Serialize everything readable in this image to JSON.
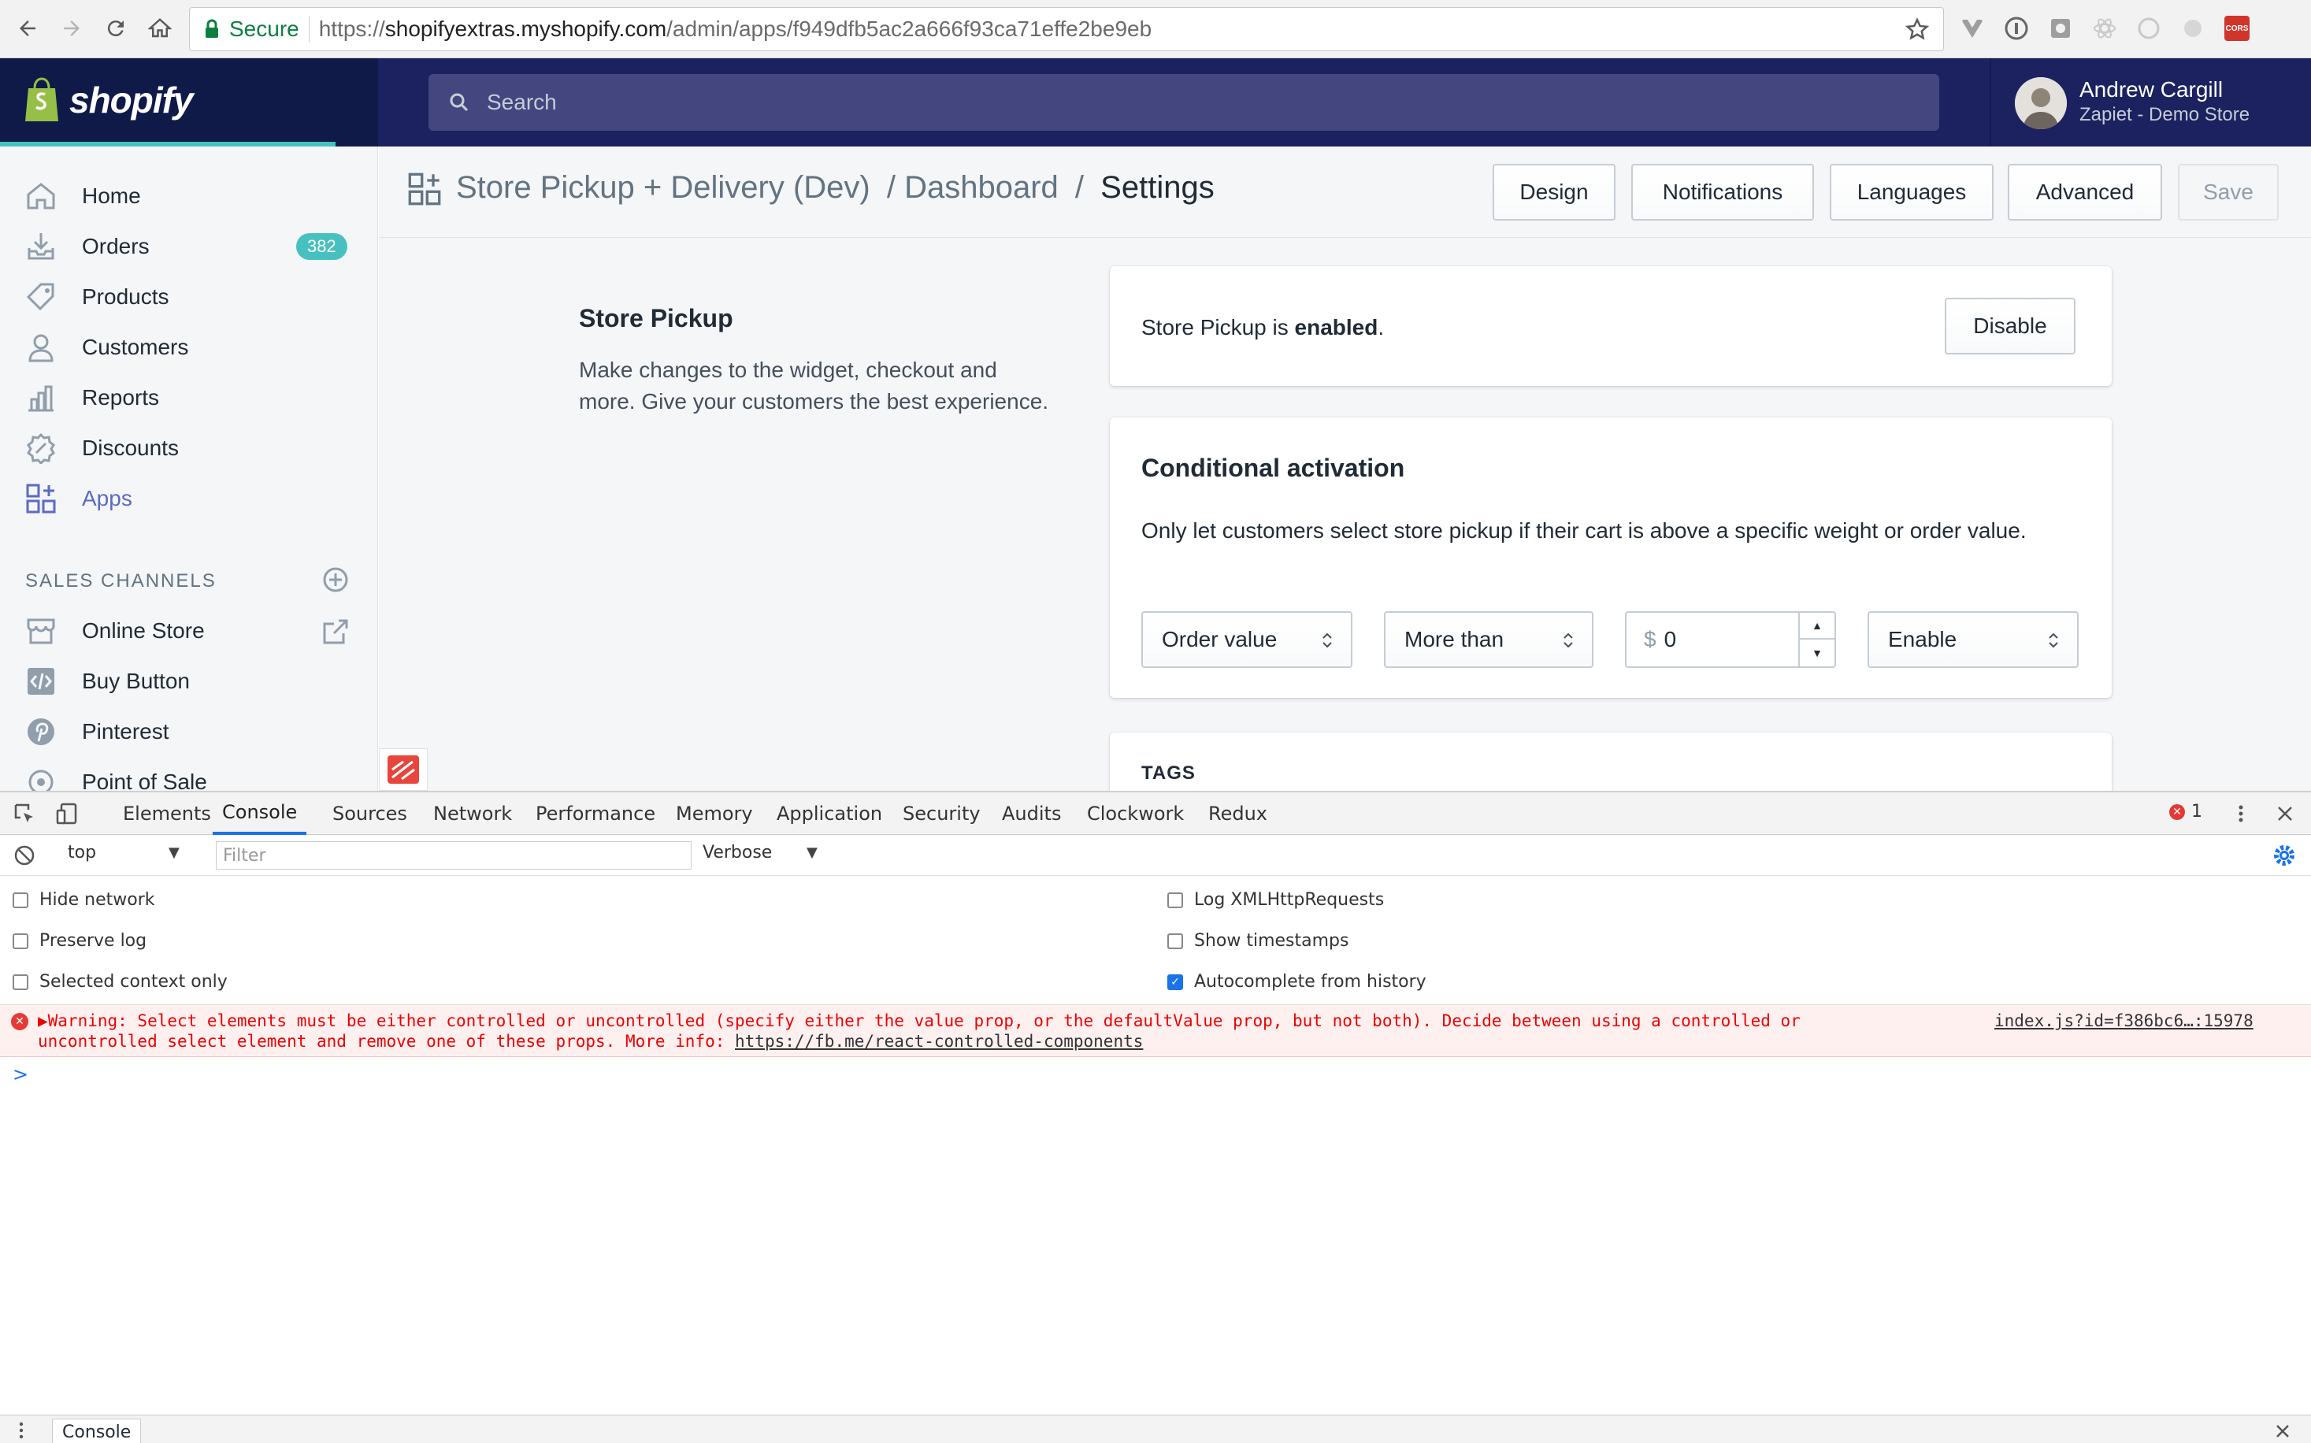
{
  "browser": {
    "secure_label": "Secure",
    "url_scheme": "https://",
    "url_host": "shopifyextras.myshopify.com",
    "url_path": "/admin/apps/f949dfb5ac2a666f93ca71effe2be9eb",
    "cors_ext_label": "CORS"
  },
  "topbar": {
    "brand": "shopify",
    "search_placeholder": "Search",
    "user_name": "Andrew Cargill",
    "user_store": "Zapiet - Demo Store"
  },
  "sidebar": {
    "items": [
      {
        "label": "Home",
        "icon": "home-icon"
      },
      {
        "label": "Orders",
        "icon": "orders-icon",
        "badge": "382"
      },
      {
        "label": "Products",
        "icon": "tag-icon"
      },
      {
        "label": "Customers",
        "icon": "person-icon"
      },
      {
        "label": "Reports",
        "icon": "bar-chart-icon"
      },
      {
        "label": "Discounts",
        "icon": "discount-icon"
      },
      {
        "label": "Apps",
        "icon": "apps-icon",
        "active": true
      }
    ],
    "channels_heading": "SALES CHANNELS",
    "channels": [
      {
        "label": "Online Store",
        "icon": "store-icon"
      },
      {
        "label": "Buy Button",
        "icon": "code-icon"
      },
      {
        "label": "Pinterest",
        "icon": "pinterest-icon"
      },
      {
        "label": "Point of Sale",
        "icon": "pos-icon"
      }
    ]
  },
  "header": {
    "crumb_app": "Store Pickup + Delivery (Dev)",
    "crumb_sep1": "/",
    "crumb_dashboard": "Dashboard",
    "crumb_sep2": "/",
    "crumb_current": "Settings",
    "buttons": {
      "design": "Design",
      "notifications": "Notifications",
      "languages": "Languages",
      "advanced": "Advanced",
      "save": "Save"
    }
  },
  "settings": {
    "section_title": "Store Pickup",
    "section_desc": "Make changes to the widget, checkout and more. Give your customers the best experience.",
    "status_prefix": "Store Pickup is ",
    "status_value": "enabled",
    "status_suffix": ".",
    "disable_button": "Disable",
    "conditional": {
      "title": "Conditional activation",
      "desc": "Only let customers select store pickup if their cart is above a specific weight or order value.",
      "metric": "Order value",
      "comparator": "More than",
      "currency": "$",
      "amount": "0",
      "action": "Enable"
    },
    "tags_title": "TAGS"
  },
  "devtools": {
    "tabs": [
      "Elements",
      "Console",
      "Sources",
      "Network",
      "Performance",
      "Memory",
      "Application",
      "Security",
      "Audits",
      "Clockwork",
      "Redux"
    ],
    "active_tab": "Console",
    "error_count": "1",
    "context": "top",
    "filter_placeholder": "Filter",
    "level": "Verbose",
    "options_left": [
      "Hide network",
      "Preserve log",
      "Selected context only"
    ],
    "options_right": [
      "Log XMLHttpRequests",
      "Show timestamps",
      "Autocomplete from history"
    ],
    "warning_line1": "▶Warning: Select elements must be either controlled or uncontrolled (specify either the value prop, or the defaultValue prop, but not both). Decide between using a controlled or",
    "warning_line2": "uncontrolled select element and remove one of these props. More info: ",
    "warning_link": "https://fb.me/react-controlled-components",
    "warning_source": "index.js?id=f386bc6…:15978",
    "prompt": ">",
    "drawer_tab": "Console"
  },
  "colors": {
    "nav_dark": "#0f1a49",
    "topbar": "#1c2260",
    "accent": "#5c6ac4",
    "teal": "#47c1bf",
    "error": "#e53935"
  }
}
